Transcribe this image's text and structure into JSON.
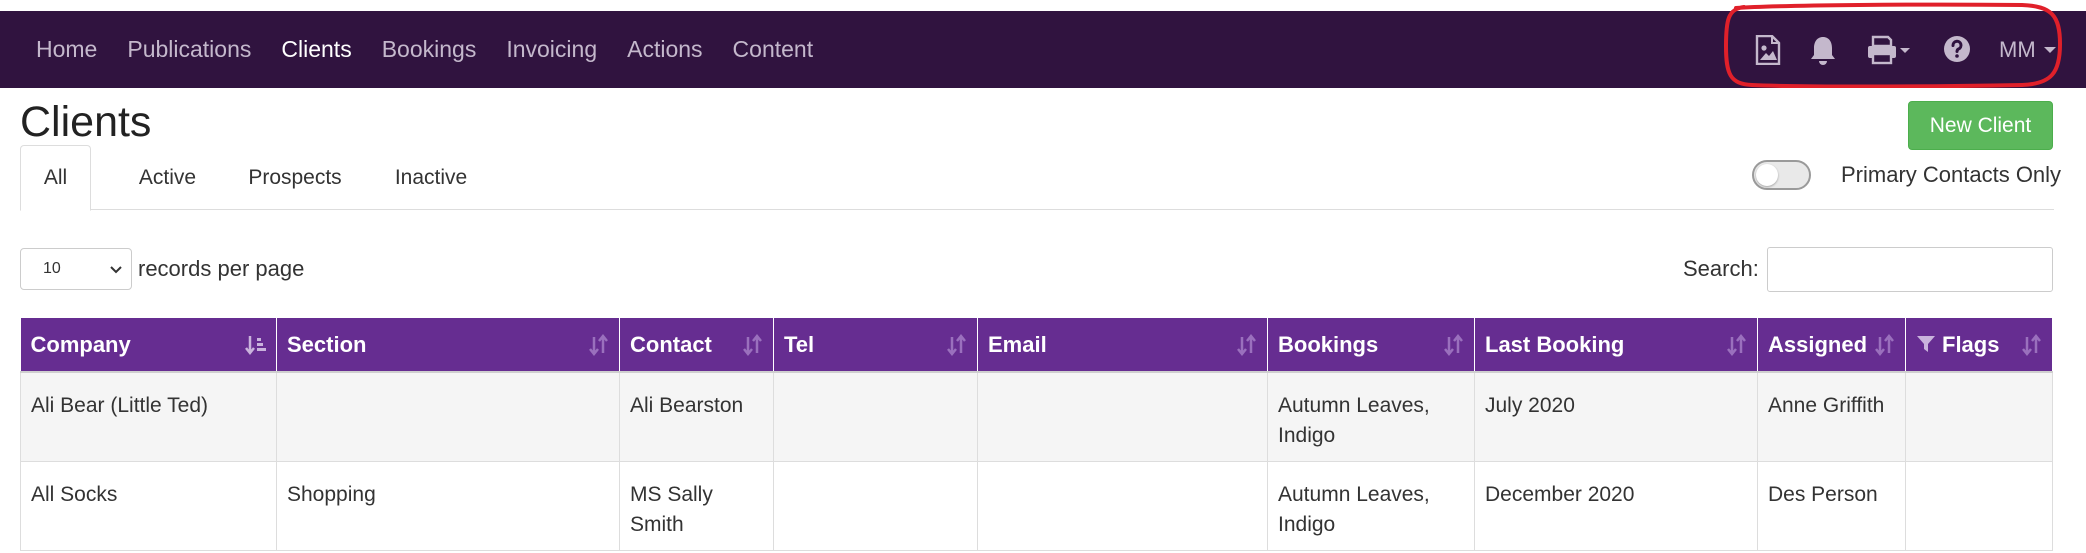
{
  "nav": {
    "links": [
      "Home",
      "Publications",
      "Clients",
      "Bookings",
      "Invoicing",
      "Actions",
      "Content"
    ],
    "active": "Clients",
    "icons": [
      "image-file-icon",
      "bell-icon",
      "print-icon",
      "help-icon"
    ],
    "user_initials": "MM"
  },
  "page": {
    "title": "Clients",
    "new_client_label": "New Client"
  },
  "tabs": [
    "All",
    "Active",
    "Prospects",
    "Inactive"
  ],
  "active_tab": "All",
  "primary_contacts": {
    "label": "Primary Contacts Only",
    "on": false
  },
  "length": {
    "value": "10",
    "label": "records per page"
  },
  "search": {
    "label": "Search:",
    "value": ""
  },
  "table": {
    "columns": [
      "Company",
      "Section",
      "Contact",
      "Tel",
      "Email",
      "Bookings",
      "Last Booking",
      "Assigned",
      "Flags"
    ],
    "rows": [
      [
        "Ali Bear (Little Ted)",
        "",
        "Ali Bearston",
        "",
        "",
        "Autumn Leaves, Indigo",
        "July 2020",
        "Anne Griffith",
        ""
      ],
      [
        "All Socks",
        "Shopping",
        "MS Sally Smith",
        "",
        "",
        "Autumn Leaves, Indigo",
        "December 2020",
        "Des Person",
        ""
      ]
    ]
  },
  "colors": {
    "nav_bg": "#30133f",
    "table_header_bg": "#662d91",
    "primary_button": "#5cb85c",
    "annotation": "#e0202a"
  }
}
